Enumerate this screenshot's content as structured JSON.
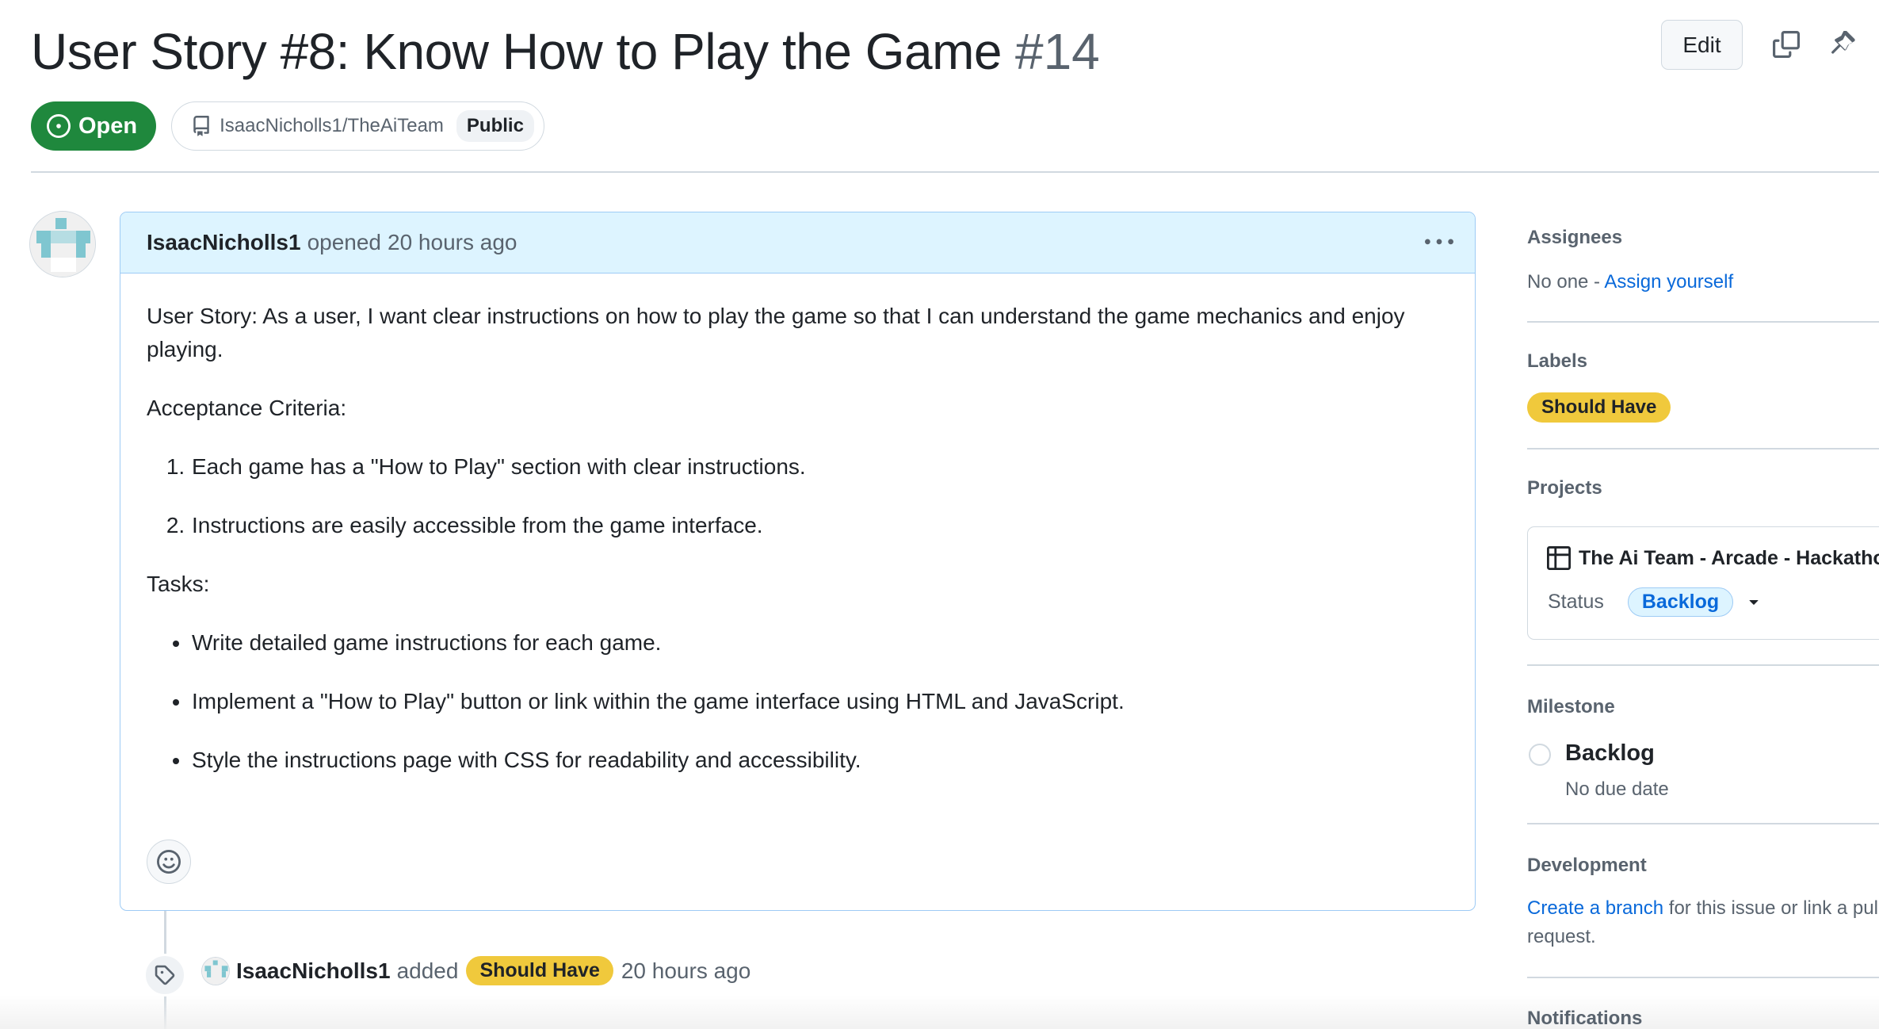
{
  "issue": {
    "title": "User Story #8: Know How to Play the Game",
    "number": "#14",
    "edit_label": "Edit",
    "status_label": "Open",
    "repo": "IsaacNicholls1/TheAiTeam",
    "visibility": "Public"
  },
  "comment": {
    "author": "IsaacNicholls1",
    "action": "opened",
    "time": "20 hours ago",
    "story": "User Story: As a user, I want clear instructions on how to play the game so that I can understand the game mechanics and enjoy playing.",
    "acceptance_heading": "Acceptance Criteria:",
    "acceptance": [
      "Each game has a \"How to Play\" section with clear instructions.",
      "Instructions are easily accessible from the game interface."
    ],
    "tasks_heading": "Tasks:",
    "tasks": [
      "Write detailed game instructions for each game.",
      "Implement a \"How to Play\" button or link within the game interface using HTML and JavaScript.",
      "Style the instructions page with CSS for readability and accessibility."
    ]
  },
  "timeline": {
    "event_author": "IsaacNicholls1",
    "event_action": "added",
    "event_label": "Should Have",
    "event_time": "20 hours ago"
  },
  "sidebar": {
    "assignees_heading": "Assignees",
    "assignees_none": "No one -",
    "assign_yourself": "Assign yourself",
    "labels_heading": "Labels",
    "label": "Should Have",
    "projects_heading": "Projects",
    "project_name": "The Ai Team - Arcade - Hackathon",
    "status_label": "Status",
    "status_value": "Backlog",
    "milestone_heading": "Milestone",
    "milestone_name": "Backlog",
    "milestone_due": "No due date",
    "development_heading": "Development",
    "create_branch": "Create a branch",
    "development_text": "for this issue or link a pull",
    "development_text2": "request.",
    "notifications_heading": "Notifications"
  },
  "colors": {
    "open_green": "#1f883d",
    "label_yellow": "#f0c93c",
    "link_blue": "#0969da",
    "comment_header_bg": "#ddf4ff"
  },
  "icons": [
    "issue-opened-icon",
    "repo-icon",
    "copy-icon",
    "pin-icon",
    "kebab-icon",
    "smiley-icon",
    "tag-icon",
    "table-icon",
    "triangle-down-icon",
    "milestone-circle-icon"
  ]
}
